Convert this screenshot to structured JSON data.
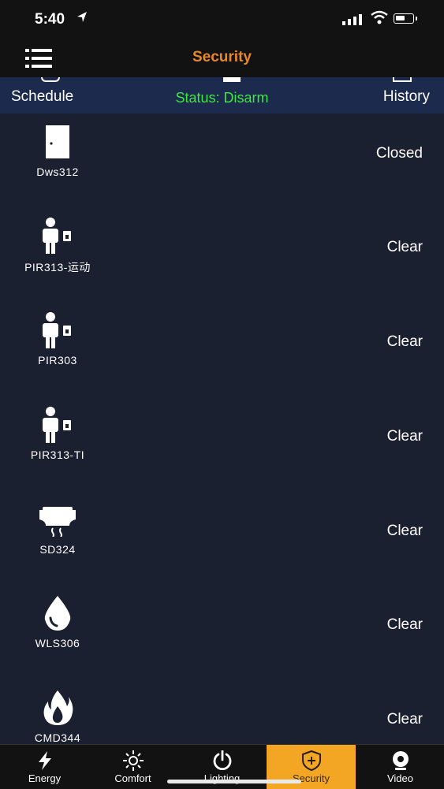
{
  "status_bar": {
    "time": "5:40"
  },
  "header": {
    "title": "Security",
    "menu_icon": "list-icon"
  },
  "subheader": {
    "schedule_label": "Schedule",
    "status_text": "Status: Disarm",
    "history_label": "History"
  },
  "devices": [
    {
      "name": "Dws312",
      "state": "Closed",
      "icon": "door-icon"
    },
    {
      "name": "PIR313-运动",
      "state": "Clear",
      "icon": "motion-sensor-icon"
    },
    {
      "name": "PIR303",
      "state": "Clear",
      "icon": "motion-sensor-icon"
    },
    {
      "name": "PIR313-TI",
      "state": "Clear",
      "icon": "motion-sensor-icon"
    },
    {
      "name": "SD324",
      "state": "Clear",
      "icon": "smoke-detector-icon"
    },
    {
      "name": "WLS306",
      "state": "Clear",
      "icon": "water-drop-icon"
    },
    {
      "name": "CMD344",
      "state": "Clear",
      "icon": "flame-icon"
    }
  ],
  "tabs": [
    {
      "label": "Energy",
      "icon": "lightning-icon",
      "active": false
    },
    {
      "label": "Comfort",
      "icon": "sun-icon",
      "active": false
    },
    {
      "label": "Lighting",
      "icon": "power-icon",
      "active": false
    },
    {
      "label": "Security",
      "icon": "shield-icon",
      "active": true
    },
    {
      "label": "Video",
      "icon": "camera-icon",
      "active": false
    }
  ],
  "colors": {
    "accent_title": "#e8862a",
    "status_green": "#3ee63e",
    "active_tab": "#f2a623",
    "background": "#1a2030"
  }
}
